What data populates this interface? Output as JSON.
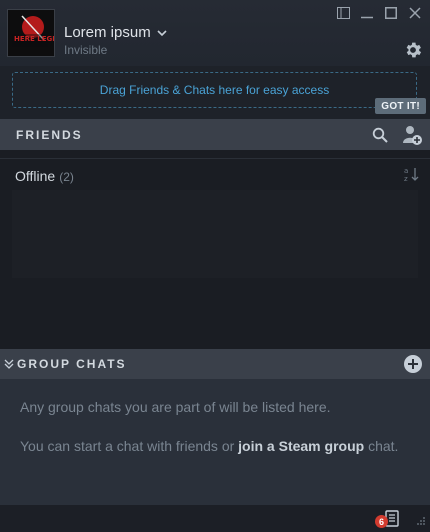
{
  "profile": {
    "name": "Lorem ipsum",
    "status": "Invisible",
    "avatar_text": "HERE LEGEN"
  },
  "drag_zone": {
    "text": "Drag Friends & Chats here for easy access",
    "got_it": "GOT IT!"
  },
  "friends": {
    "title": "FRIENDS",
    "group_label": "Offline",
    "group_count": "(2)"
  },
  "group_chats": {
    "title": "GROUP CHATS",
    "empty_message": "Any group chats you are part of will be listed here.",
    "hint_prefix": "You can start a chat with friends or",
    "hint_link": "join a Steam group",
    "hint_suffix": "chat."
  },
  "footer": {
    "notification_count": "6"
  },
  "colors": {
    "accent": "#4aa3d6",
    "badge": "#d23b2f",
    "header_bg": "#3a404a"
  },
  "icons": [
    "restore-icon",
    "minimize-icon",
    "maximize-icon",
    "close-icon",
    "chevron-down-icon",
    "gear-icon",
    "search-icon",
    "add-friend-icon",
    "sort-icon",
    "collapse-icon",
    "add-group-chat-icon",
    "notifications-icon",
    "resize-grip-icon"
  ]
}
